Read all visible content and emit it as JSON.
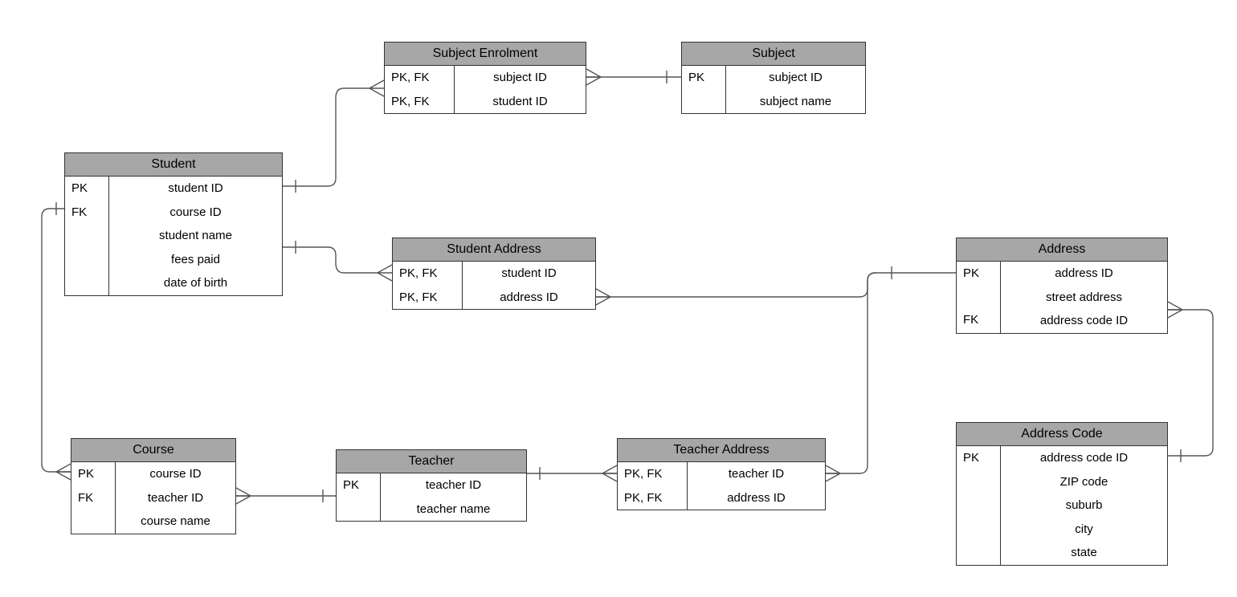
{
  "entities": {
    "student": {
      "title": "Student",
      "keys": [
        "PK",
        "FK",
        "",
        "",
        ""
      ],
      "fields": [
        "student ID",
        "course ID",
        "student name",
        "fees paid",
        "date of birth"
      ]
    },
    "subject_enrolment": {
      "title": "Subject Enrolment",
      "keys": [
        "PK, FK",
        "PK, FK"
      ],
      "fields": [
        "subject ID",
        "student ID"
      ]
    },
    "subject": {
      "title": "Subject",
      "keys": [
        "PK",
        ""
      ],
      "fields": [
        "subject ID",
        "subject name"
      ]
    },
    "student_address": {
      "title": "Student Address",
      "keys": [
        "PK, FK",
        "PK, FK"
      ],
      "fields": [
        "student ID",
        "address ID"
      ]
    },
    "address": {
      "title": "Address",
      "keys": [
        "PK",
        "",
        "FK"
      ],
      "fields": [
        "address ID",
        "street address",
        "address code ID"
      ]
    },
    "course": {
      "title": "Course",
      "keys": [
        "PK",
        "FK",
        ""
      ],
      "fields": [
        "course ID",
        "teacher ID",
        "course name"
      ]
    },
    "teacher": {
      "title": "Teacher",
      "keys": [
        "PK",
        ""
      ],
      "fields": [
        "teacher ID",
        "teacher name"
      ]
    },
    "teacher_address": {
      "title": "Teacher Address",
      "keys": [
        "PK, FK",
        "PK, FK"
      ],
      "fields": [
        "teacher ID",
        "address ID"
      ]
    },
    "address_code": {
      "title": "Address Code",
      "keys": [
        "PK",
        "",
        "",
        "",
        ""
      ],
      "fields": [
        "address code ID",
        "ZIP code",
        "suburb",
        "city",
        "state"
      ]
    }
  }
}
